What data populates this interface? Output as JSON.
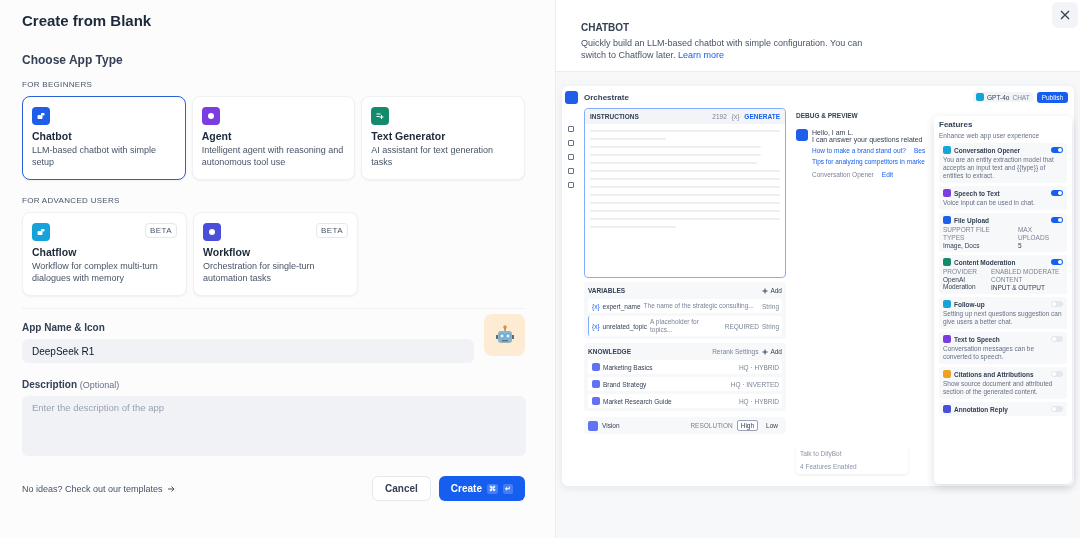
{
  "title": "Create from Blank",
  "section_title": "Choose App Type",
  "groups": [
    {
      "label": "FOR BEGINNERS",
      "types": [
        {
          "name": "Chatbot",
          "description": "LLM-based chatbot with simple setup",
          "color": "#1f5ee8",
          "selected": true
        },
        {
          "name": "Agent",
          "description": "Intelligent agent with reasoning and autonomous tool use",
          "color": "#7a3ee0",
          "selected": false
        },
        {
          "name": "Text Generator",
          "description": "AI assistant for text generation tasks",
          "color": "#138a6c",
          "selected": false
        }
      ]
    },
    {
      "label": "FOR ADVANCED USERS",
      "types": [
        {
          "name": "Chatflow",
          "description": "Workflow for complex multi-turn dialogues with memory",
          "color": "#16a3d9",
          "selected": false,
          "badge": "BETA"
        },
        {
          "name": "Workflow",
          "description": "Orchestration for single-turn automation tasks",
          "color": "#4a4fd9",
          "selected": false,
          "badge": "BETA"
        }
      ]
    }
  ],
  "name_field": {
    "label": "App Name & Icon",
    "value": "DeepSeek R1"
  },
  "description_field": {
    "label": "Description",
    "note": "(Optional)",
    "placeholder": "Enter the description of the app"
  },
  "templates_link": "No ideas? Check out our templates",
  "cancel_button": "Cancel",
  "create_button": {
    "label": "Create",
    "keys": [
      "⌘",
      "↵"
    ]
  },
  "preview": {
    "title": "CHATBOT",
    "description": "Quickly build an LLM-based chatbot with simple configuration. You can switch to Chatflow later.",
    "link": "Learn more"
  },
  "mockup": {
    "header": "Orchestrate",
    "instructions": {
      "label": "INSTRUCTIONS",
      "count": "2192",
      "variable_tag": "{x}",
      "generate": "GENERATE"
    },
    "variables": {
      "label": "VARIABLES",
      "add": "Add",
      "rows": [
        {
          "tag": "{x}",
          "name": "expert_name",
          "description": "The name of the strategic consulting...",
          "required": false,
          "type": "String"
        },
        {
          "tag": "{x}",
          "name": "unrelated_topic",
          "description": "A placeholder for topics...",
          "required": true,
          "required_label": "REQUIRED",
          "type": "String"
        }
      ]
    },
    "knowledge": {
      "label": "KNOWLEDGE",
      "rerank": "Rerank Settings",
      "add": "Add",
      "items": [
        {
          "name": "Marketing Basics",
          "mode": "HQ · HYBRID"
        },
        {
          "name": "Brand Strategy",
          "mode": "HQ · INVERTED"
        },
        {
          "name": "Market Research Guide",
          "mode": "HQ · HYBRID"
        }
      ]
    },
    "vision": {
      "label": "Vision",
      "resolution": "RESOLUTION",
      "options": [
        {
          "label": "High",
          "selected": true
        },
        {
          "label": "Low",
          "selected": false
        }
      ]
    },
    "model": {
      "name": "GPT-4o",
      "mode": "CHAT"
    },
    "publish": "Publish",
    "debug": {
      "title": "DEBUG & PREVIEW",
      "greeting": [
        "Hello, I am L.",
        "I can answer your questions related"
      ],
      "suggestions": [
        "How to make a brand stand out?",
        "Bes",
        "Tips for analyzing competitors in marke"
      ],
      "opener": "Conversation Opener",
      "edit": "Edit",
      "input_placeholder": "Talk to DifyBot",
      "enabled": "4 Features Enabled"
    },
    "features": {
      "title": "Features",
      "subtitle": "Enhance web app user experience",
      "items": [
        {
          "kind": "text",
          "name": "Conversation Opener",
          "on": true,
          "color": "#16a3d9",
          "description": "You are an entity extraction model that accepts an input text and {{type}} of entities to extract."
        },
        {
          "kind": "text",
          "name": "Speech to Text",
          "on": true,
          "color": "#7a3ee0",
          "description": "Voice input can be used in chat."
        },
        {
          "kind": "details",
          "name": "File Upload",
          "on": true,
          "color": "#1f5ee8",
          "details": [
            {
              "label": "SUPPORT FILE TYPES",
              "value": "Image, Docs"
            },
            {
              "label": "MAX UPLOADS",
              "value": "5"
            }
          ]
        },
        {
          "kind": "details",
          "name": "Content Moderation",
          "on": true,
          "color": "#138a6c",
          "details": [
            {
              "label": "PROVIDER",
              "value": "OpenAI Moderation"
            },
            {
              "label": "ENABLED MODERATE CONTENT",
              "value": "INPUT & OUTPUT"
            }
          ]
        },
        {
          "kind": "text",
          "name": "Follow-up",
          "on": false,
          "color": "#16a3d9",
          "description": "Setting up next questions suggestion can give users a better chat."
        },
        {
          "kind": "text",
          "name": "Text to Speech",
          "on": false,
          "color": "#7a3ee0",
          "description": "Conversation messages can be converted to speech."
        },
        {
          "kind": "text",
          "name": "Citations and Attributions",
          "on": false,
          "color": "#f0a020",
          "description": "Show source document and attributed section of the generated content."
        },
        {
          "kind": "title",
          "name": "Annotation Reply",
          "on": false,
          "color": "#4a4fd9"
        }
      ]
    }
  }
}
